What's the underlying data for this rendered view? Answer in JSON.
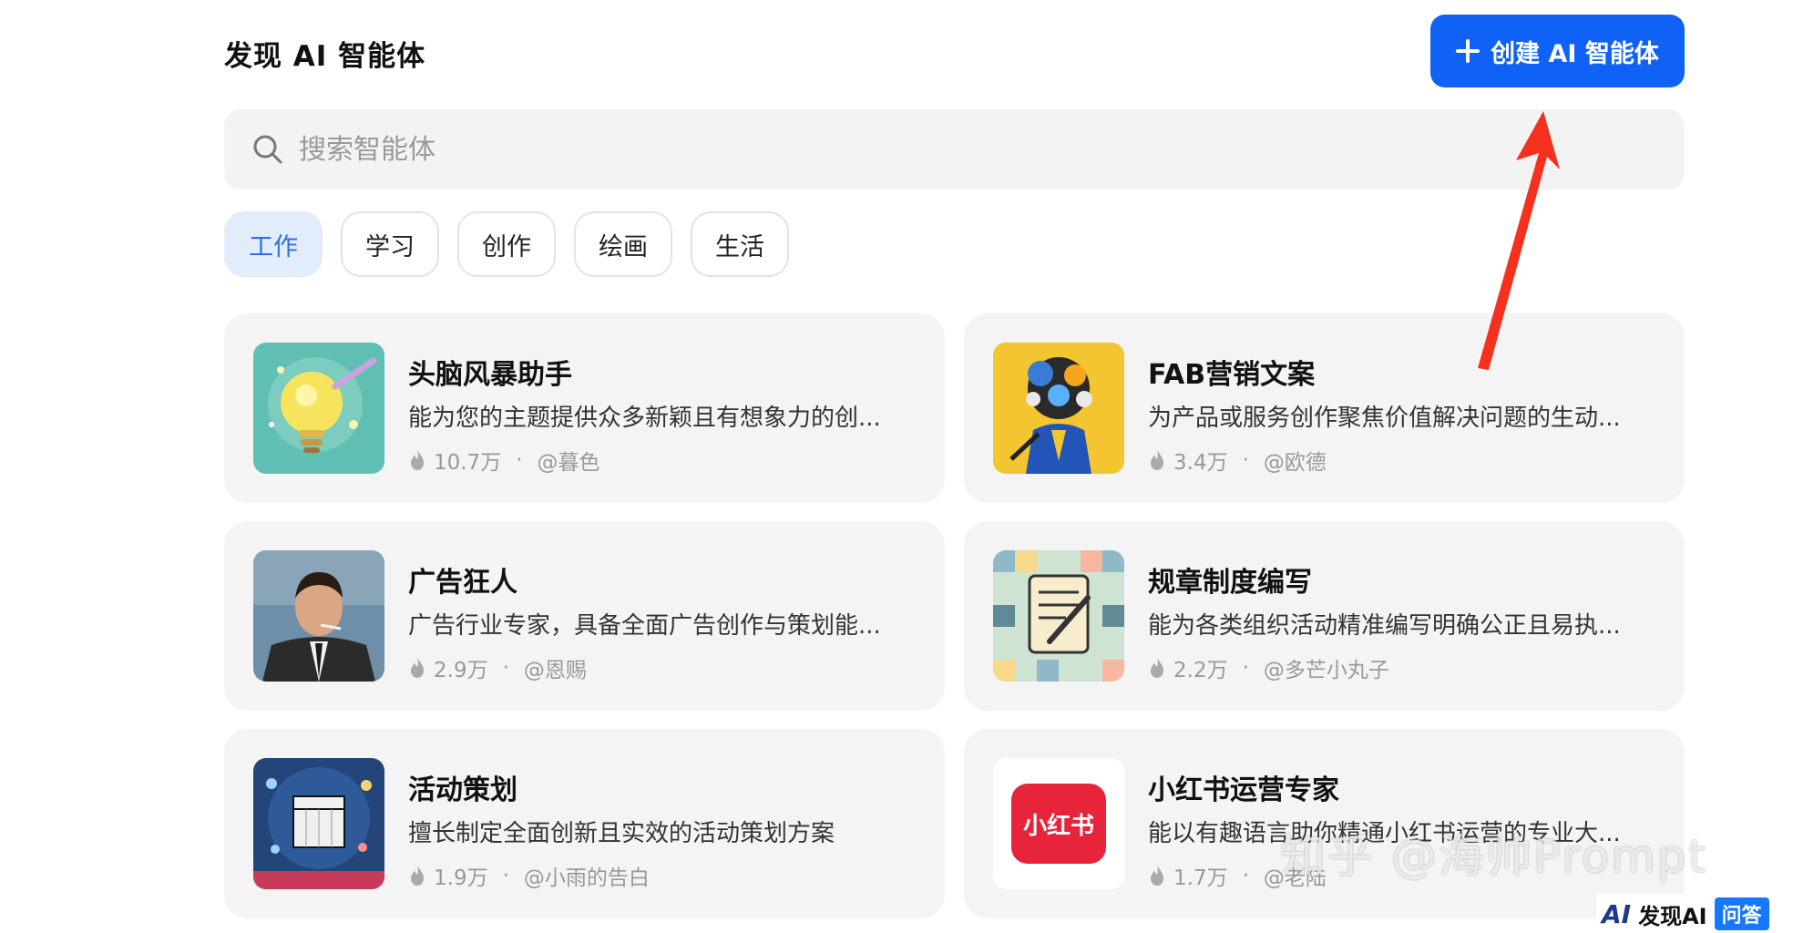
{
  "header": {
    "title": "发现 AI 智能体",
    "create_button": "创建 AI 智能体"
  },
  "search": {
    "placeholder": "搜索智能体",
    "value": ""
  },
  "tabs": [
    {
      "label": "工作",
      "active": true
    },
    {
      "label": "学习",
      "active": false
    },
    {
      "label": "创作",
      "active": false
    },
    {
      "label": "绘画",
      "active": false
    },
    {
      "label": "生活",
      "active": false
    }
  ],
  "cards": [
    {
      "name": "头脑风暴助手",
      "desc": "能为您的主题提供众多新颖且有想象力的创...",
      "count": "10.7万",
      "author": "@暮色",
      "icon": "lightbulb-icon"
    },
    {
      "name": "FAB营销文案",
      "desc": "为产品或服务创作聚焦价值解决问题的生动...",
      "count": "3.4万",
      "author": "@欧德",
      "icon": "gears-head-icon"
    },
    {
      "name": "广告狂人",
      "desc": "广告行业专家，具备全面广告创作与策划能...",
      "count": "2.9万",
      "author": "@恩赐",
      "icon": "portrait-icon"
    },
    {
      "name": "规章制度编写",
      "desc": "能为各类组织活动精准编写明确公正且易执...",
      "count": "2.2万",
      "author": "@多芒小丸子",
      "icon": "document-pen-icon"
    },
    {
      "name": "活动策划",
      "desc": "擅长制定全面创新且实效的活动策划方案",
      "count": "1.9万",
      "author": "@小雨的告白",
      "icon": "planning-board-icon"
    },
    {
      "name": "小红书运营专家",
      "desc": "能以有趣语言助你精通小红书运营的专业大...",
      "count": "1.7万",
      "author": "@老陆",
      "icon": "xiaohongshu-logo-icon",
      "logo_text": "小红书"
    }
  ],
  "watermark": {
    "text": "知乎 @海帅Prompt",
    "badge_logo": "AI",
    "badge_text": "发现AI",
    "badge_qa": "问答"
  },
  "colors": {
    "accent": "#0f62f5",
    "tab_active_bg": "#e2ecfb",
    "tab_active_text": "#2f6fe0",
    "card_bg": "#f4f4f4",
    "annotation_arrow": "#f5301d"
  }
}
